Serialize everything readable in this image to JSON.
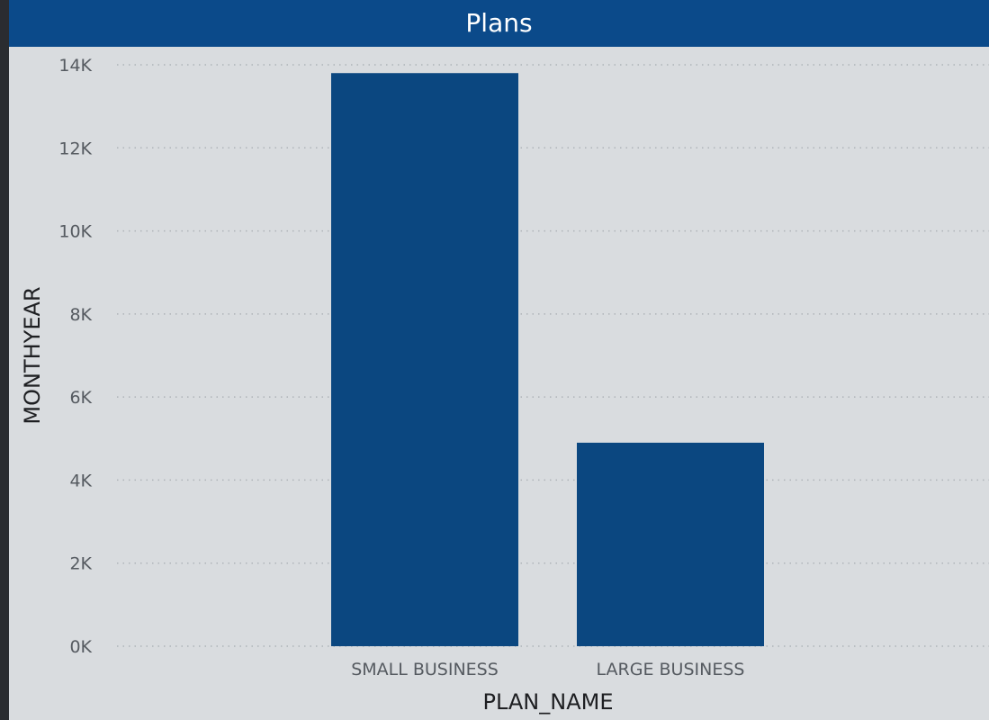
{
  "chart_data": {
    "type": "bar",
    "title": "Plans",
    "categories": [
      "SMALL BUSINESS",
      "LARGE BUSINESS"
    ],
    "values": [
      13800,
      4900
    ],
    "xlabel": "PLAN_NAME",
    "ylabel": "MONTHYEAR",
    "ylim": [
      0,
      14000
    ],
    "yticks": [
      0,
      2000,
      4000,
      6000,
      8000,
      10000,
      12000,
      14000
    ],
    "ytick_labels": [
      "0K",
      "2K",
      "4K",
      "6K",
      "8K",
      "10K",
      "12K",
      "14K"
    ],
    "grid": true,
    "bar_color": "#0b4780",
    "title_bar_color": "#0b4a8a"
  }
}
